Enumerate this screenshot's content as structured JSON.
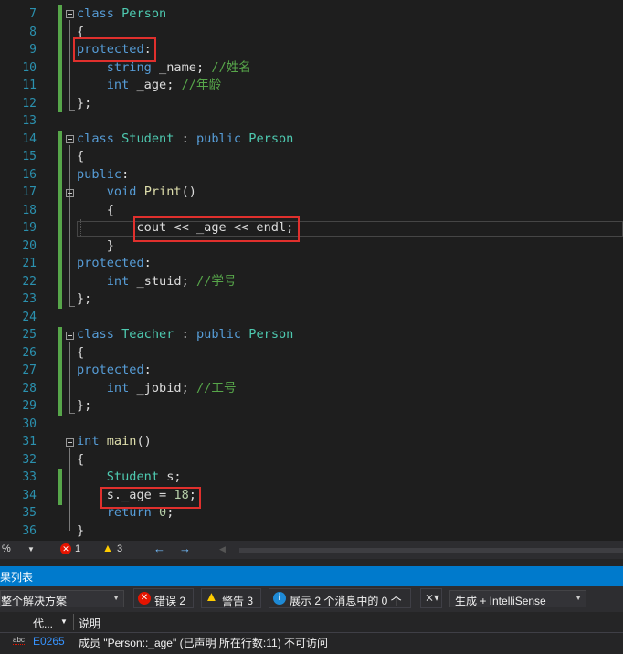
{
  "editor": {
    "lines": [
      {
        "n": "7"
      },
      {
        "n": "8"
      },
      {
        "n": "9"
      },
      {
        "n": "10"
      },
      {
        "n": "11"
      },
      {
        "n": "12"
      },
      {
        "n": "13"
      },
      {
        "n": "14"
      },
      {
        "n": "15"
      },
      {
        "n": "16"
      },
      {
        "n": "17"
      },
      {
        "n": "18"
      },
      {
        "n": "19"
      },
      {
        "n": "20"
      },
      {
        "n": "21"
      },
      {
        "n": "22"
      },
      {
        "n": "23"
      },
      {
        "n": "24"
      },
      {
        "n": "25"
      },
      {
        "n": "26"
      },
      {
        "n": "27"
      },
      {
        "n": "28"
      },
      {
        "n": "29"
      },
      {
        "n": "30"
      },
      {
        "n": "31"
      },
      {
        "n": "32"
      },
      {
        "n": "33"
      },
      {
        "n": "34"
      },
      {
        "n": "35"
      },
      {
        "n": "36"
      }
    ],
    "code": {
      "l7_kw": "class",
      "l7_name": "Person",
      "l8": "{",
      "l9_kw": "protected",
      "l10_type": "string",
      "l10_var": " _name; ",
      "l10_cm": "//姓名",
      "l11_type": "int",
      "l11_var": " _age; ",
      "l11_cm": "//年龄",
      "l12": "};",
      "l14_kw": "class",
      "l14_name": "Student",
      "l14_colon": " : ",
      "l14_pub": "public",
      "l14_base": "Person",
      "l15": "{",
      "l16_kw": "public",
      "l17_type": "void",
      "l17_fn": "Print",
      "l17_paren": "()",
      "l18": "{",
      "l19": "cout << _age << endl;",
      "l20": "}",
      "l21_kw": "protected",
      "l22_type": "int",
      "l22_var": " _stuid; ",
      "l22_cm": "//学号",
      "l23": "};",
      "l25_kw": "class",
      "l25_name": "Teacher",
      "l25_colon": " : ",
      "l25_pub": "public",
      "l25_base": "Person",
      "l26": "{",
      "l27_kw": "protected",
      "l28_type": "int",
      "l28_var": " _jobid; ",
      "l28_cm": "//工号",
      "l29": "};",
      "l31_type": "int",
      "l31_fn": "main",
      "l31_paren": "()",
      "l32": "{",
      "l33_type": "Student",
      "l33_var": " s;",
      "l34_a": "s._age = ",
      "l34_num": "18",
      "l34_b": ";",
      "l35_kw": "return",
      "l35_num": "0",
      "l35_b": ";",
      "l36": "}"
    }
  },
  "status_strip": {
    "zoom": "%",
    "errors": "1",
    "warnings": "3"
  },
  "error_list": {
    "title": "果列表",
    "scope": "整个解决方案",
    "errors_button": "错误 2",
    "warnings_button": "警告 3",
    "messages_button": "展示 2 个消息中的 0 个",
    "build_filter": "生成 + IntelliSense",
    "col_code": "代...",
    "col_desc": "说明",
    "row_code": "E0265",
    "row_desc": "成员 \"Person::_age\" (已声明 所在行数:11) 不可访问",
    "colors": {
      "error": "#e51400",
      "warning": "#ffcc00",
      "accent": "#007acc",
      "highlight": "#e0302d"
    }
  }
}
